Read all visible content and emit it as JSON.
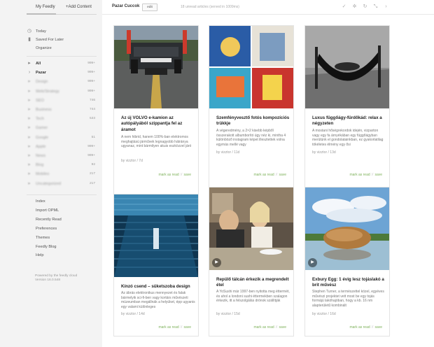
{
  "sidebar": {
    "tabs": [
      "My Feedly",
      "+Add Content"
    ],
    "top_items": [
      {
        "label": "Today",
        "icon": "today-icon"
      },
      {
        "label": "Saved For Later",
        "icon": "bookmark-icon"
      },
      {
        "label": "Organize",
        "icon": ""
      }
    ],
    "categories": [
      {
        "label": "All",
        "count": "999+"
      },
      {
        "label": "Pazar",
        "count": "999+"
      },
      {
        "label": "Design",
        "count": "999+"
      },
      {
        "label": "Web/Strategy",
        "count": "999+"
      },
      {
        "label": "SEO",
        "count": "746"
      },
      {
        "label": "Business",
        "count": "744"
      },
      {
        "label": "Tech",
        "count": "533"
      },
      {
        "label": "Gamer",
        "count": ""
      },
      {
        "label": "Google",
        "count": "51"
      },
      {
        "label": "Apple",
        "count": "999+"
      },
      {
        "label": "News",
        "count": "999+"
      },
      {
        "label": "Blog",
        "count": "92"
      },
      {
        "label": "Mobiles",
        "count": "217"
      },
      {
        "label": "Uncategorized",
        "count": "217"
      }
    ],
    "bottom_items": [
      "Index",
      "Import OPML",
      "Recently Read",
      "Preferences",
      "Themes",
      "Feedly Blog",
      "Help"
    ],
    "footer": [
      "Powered by the feedly cloud",
      "Version 16.0.548"
    ]
  },
  "topbar": {
    "title": "Pazar Cuccok",
    "edit": "edit",
    "unread": "18 unread articles (served in 1009ms)"
  },
  "colors": {
    "accent": "#7fb25c",
    "sidebar_bg": "#f3f3f3"
  },
  "cards": [
    {
      "title": "Az új VOLVO e-kamion az autópályából szippantja fel az áramot",
      "snippet": "A nem hibrid, hanem 100%-ban elektromos meghajtású járművek legnagyobb hátránya ugyanaz, mint bármilyen akuis eszközzel járó",
      "meta": "by vizztor / 7d",
      "action1": "mark as read",
      "action2": "save",
      "image": "truck",
      "video": false
    },
    {
      "title": "Szemfényvesztő fotós kompozíciós trükkje",
      "snippet": "A végeredmény, a 2×2 kisebb képből összerakott albumborító úgy néz ki, mintha 4 különböző instagram képet illesztettek volna egymás mellé vagy",
      "meta": "by vizztor / 11d",
      "action1": "mark as read",
      "action2": "save",
      "image": "collage",
      "video": false
    },
    {
      "title": "Luxus függőágy-fürdőkád: relax a négyzeten",
      "snippet": "A mostani hőségrekordok idején, vizparton vagy egy fa árnyékában egy függőágyban merülünk el gondolatainkban, ez gyakorlatilag tökéletes élmény egy ősi",
      "meta": "by vizztor / 13d",
      "action1": "mark as read",
      "action2": "save",
      "image": "hammock",
      "video": false
    },
    {
      "title": "Kínzó csend – süketszoba design",
      "snippet": "Az ábrás elektronikus mennyezet és falak bármelyik sci-fi-ben vagy kortárs művészeti múzeumban megállnák a helyüket, épp ugyanis egy valami különleges",
      "meta": "by vizztor / 14d",
      "action1": "mark as read",
      "action2": "save",
      "image": "anechoic",
      "video": false
    },
    {
      "title": "Repülő tálcán érkezik a megrendelt étel",
      "snippet": "A YoSushi már 1997-ben nyitotta meg éttermét, és ahol a londoni sushi éttermekben szalagon érkezik, itt a felszolgálás drónok szállítják",
      "meta": "by vizztor / 15d",
      "action1": "mark as read",
      "action2": "save",
      "image": "restaurant",
      "video": true
    },
    {
      "title": "Exbury Egg: 1 évig lesz tojáslakó a brit művész",
      "snippet": "Stephen Turner, a természettel közel, egyéves művészi projektet vett most be egy tojás formájú lakóhajóban, hogy a kb. 16 nm alapterületű kombinált",
      "meta": "by vizztor / 16d",
      "action1": "mark as read",
      "action2": "save",
      "image": "egg",
      "video": true
    }
  ]
}
